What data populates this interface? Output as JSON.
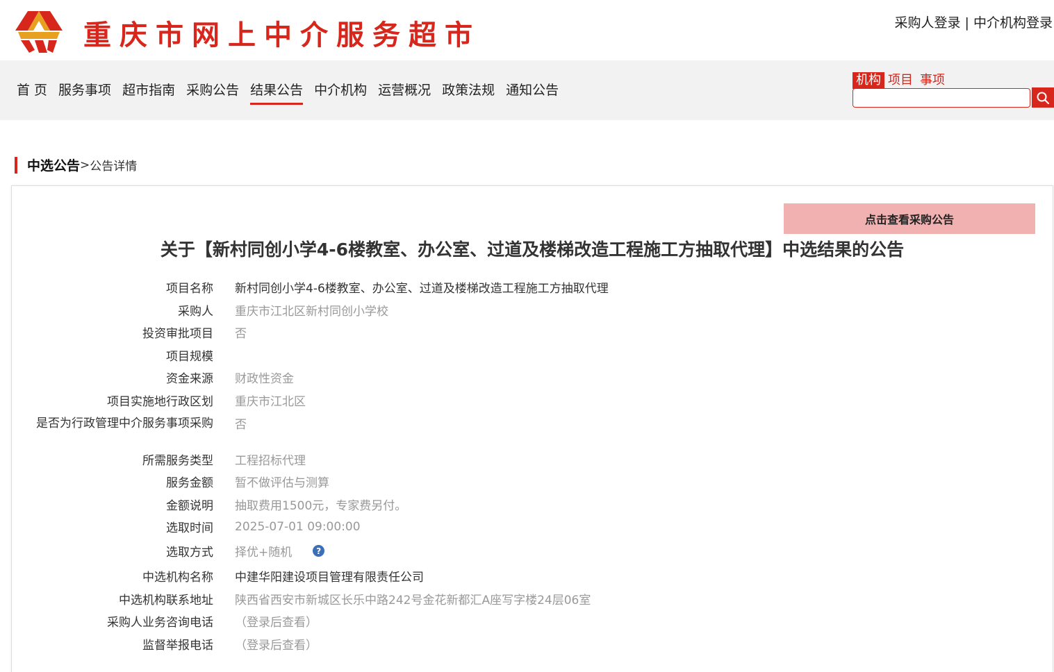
{
  "header": {
    "site_title": "重庆市网上中介服务超市",
    "login_buyer": "采购人登录",
    "login_separator": "|",
    "login_agency": "中介机构登录"
  },
  "nav": {
    "items": [
      {
        "label": "首 页"
      },
      {
        "label": "服务事项"
      },
      {
        "label": "超市指南"
      },
      {
        "label": "采购公告"
      },
      {
        "label": "结果公告",
        "active": true
      },
      {
        "label": "中介机构"
      },
      {
        "label": "运营概况"
      },
      {
        "label": "政策法规"
      },
      {
        "label": "通知公告"
      }
    ]
  },
  "search": {
    "tabs": [
      "机构",
      "项目",
      "事项"
    ],
    "active_tab": "机构",
    "value": "",
    "icon": "search-icon"
  },
  "breadcrumb": {
    "current": "中选公告",
    "separator": ">",
    "detail": "公告详情"
  },
  "view_notice_button": "点击查看采购公告",
  "title": "关于【新村同创小学4-6楼教室、办公室、过道及楼梯改造工程施工方抽取代理】中选结果的公告",
  "fields": [
    {
      "label": "项目名称",
      "value": "新村同创小学4-6楼教室、办公室、过道及楼梯改造工程施工方抽取代理"
    },
    {
      "label": "采购人",
      "value": "重庆市江北区新村同创小学校"
    },
    {
      "label": "投资审批项目",
      "value": "否"
    },
    {
      "label": "项目规模",
      "value": ""
    },
    {
      "label": "资金来源",
      "value": "财政性资金"
    },
    {
      "label": "项目实施地行政区划",
      "value": "重庆市江北区"
    },
    {
      "label": "是否为行政管理中介服务事项采购",
      "value": "否"
    },
    {
      "label": "所需服务类型",
      "value": "工程招标代理"
    },
    {
      "label": "服务金额",
      "value": "暂不做评估与测算"
    },
    {
      "label": "金额说明",
      "value": "抽取费用1500元，专家费另付。"
    },
    {
      "label": "选取时间",
      "value": "2025-07-01 09:00:00"
    },
    {
      "label": "选取方式",
      "value": "择优+随机"
    },
    {
      "label": "中选机构名称",
      "value": "中建华阳建设项目管理有限责任公司"
    },
    {
      "label": "中选机构联系地址",
      "value": "陕西省西安市新城区长乐中路242号金花新都汇A座写字楼24层06室"
    },
    {
      "label": "采购人业务咨询电话",
      "value": "（登录后查看）"
    },
    {
      "label": "监督举报电话",
      "value": "（登录后查看）"
    }
  ],
  "colors": {
    "brand_red": "#d7261b",
    "button_pink": "#f2b1b1",
    "help_blue": "#3c6fb6"
  }
}
